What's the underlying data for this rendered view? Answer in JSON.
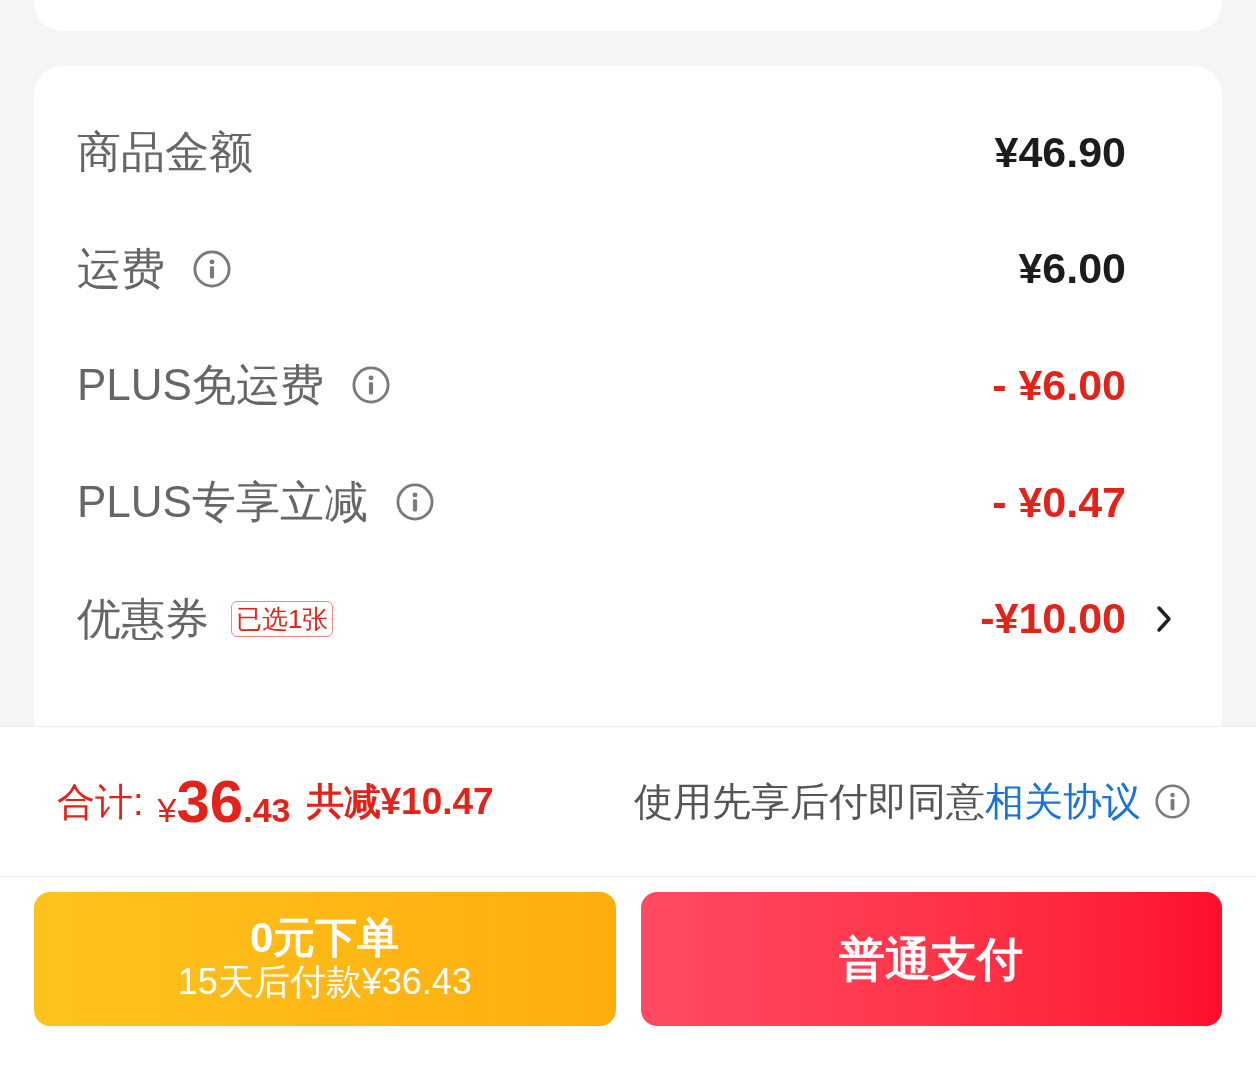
{
  "summary_card": {
    "rows": [
      {
        "kind": "amount",
        "label": "商品金额",
        "info": false,
        "value": "¥46.90",
        "chevron": false
      },
      {
        "kind": "amount",
        "label": "运费",
        "info": true,
        "value": "¥6.00",
        "chevron": false
      },
      {
        "kind": "discount",
        "label": "PLUS免运费",
        "info": true,
        "value": "- ¥6.00",
        "chevron": false
      },
      {
        "kind": "discount",
        "label": "PLUS专享立减",
        "info": true,
        "value": "- ¥0.47",
        "chevron": false
      },
      {
        "kind": "discount",
        "label": "优惠券",
        "info": false,
        "badge": "已选1张",
        "value": "-¥10.00",
        "chevron": true
      }
    ]
  },
  "footer": {
    "total": {
      "label": "合计:",
      "currency": "¥",
      "integer": "36",
      "decimal": ".43",
      "saving": "共减¥10.47"
    },
    "agreement": {
      "text": "使用先享后付即同意",
      "link": "相关协议",
      "info": true
    },
    "buttons": [
      {
        "kind": "pay_later",
        "title": "0元下单",
        "subtitle": "15天后付款¥36.43"
      },
      {
        "kind": "pay_now",
        "title": "普通支付"
      }
    ]
  }
}
